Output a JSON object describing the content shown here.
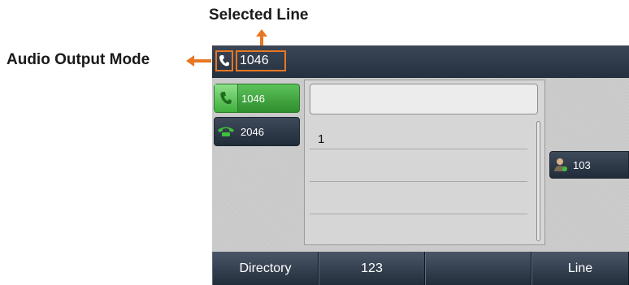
{
  "callouts": {
    "selected_line": "Selected Line",
    "audio_output_mode": "Audio Output Mode",
    "color": "#e87722"
  },
  "status_bar": {
    "selected_line": "1046",
    "audio_icon": "handset-icon"
  },
  "line_keys": [
    {
      "label": "1046",
      "icon": "handset-icon",
      "state": "active"
    },
    {
      "label": "2046",
      "icon": "telephone-icon",
      "state": "idle"
    }
  ],
  "main_panel": {
    "input_value": "",
    "entries": [
      "1"
    ]
  },
  "contact_key": {
    "label": "103",
    "icon": "contact-person-icon"
  },
  "softkeys": [
    "Directory",
    "123",
    "",
    "Line"
  ],
  "colors": {
    "active_green": "#3fae3c",
    "key_dark": "#2a3544",
    "accent_orange": "#e87722"
  }
}
